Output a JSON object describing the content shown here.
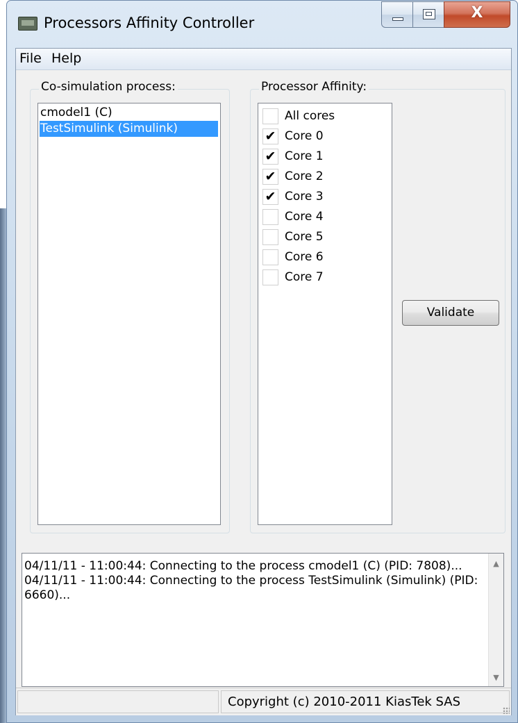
{
  "window": {
    "title": "Processors Affinity Controller",
    "close_glyph": "X"
  },
  "menu": {
    "items": [
      "File",
      "Help"
    ]
  },
  "cosim": {
    "group_label": "Co-simulation process:",
    "processes": [
      {
        "label": "cmodel1 (C)",
        "selected": false
      },
      {
        "label": "TestSimulink (Simulink)",
        "selected": true
      }
    ]
  },
  "affinity": {
    "group_label": "Processor Affinity:",
    "cores": [
      {
        "label": "All cores",
        "checked": false
      },
      {
        "label": "Core 0",
        "checked": true
      },
      {
        "label": "Core 1",
        "checked": true
      },
      {
        "label": "Core 2",
        "checked": true
      },
      {
        "label": "Core 3",
        "checked": true
      },
      {
        "label": "Core 4",
        "checked": false
      },
      {
        "label": "Core 5",
        "checked": false
      },
      {
        "label": "Core 6",
        "checked": false
      },
      {
        "label": "Core 7",
        "checked": false
      }
    ],
    "validate_label": "Validate",
    "check_glyph": "✔"
  },
  "log": {
    "lines": [
      "04/11/11 - 11:00:44: Connecting to the process cmodel1 (C) (PID: 7808)...",
      "04/11/11 - 11:00:44: Connecting to the process TestSimulink (Simulink) (PID: 6660)..."
    ],
    "scroll_up_glyph": "▲",
    "scroll_down_glyph": "▼"
  },
  "status": {
    "left_text": "",
    "copyright": "Copyright (c) 2010-2011 KiasTek SAS"
  }
}
